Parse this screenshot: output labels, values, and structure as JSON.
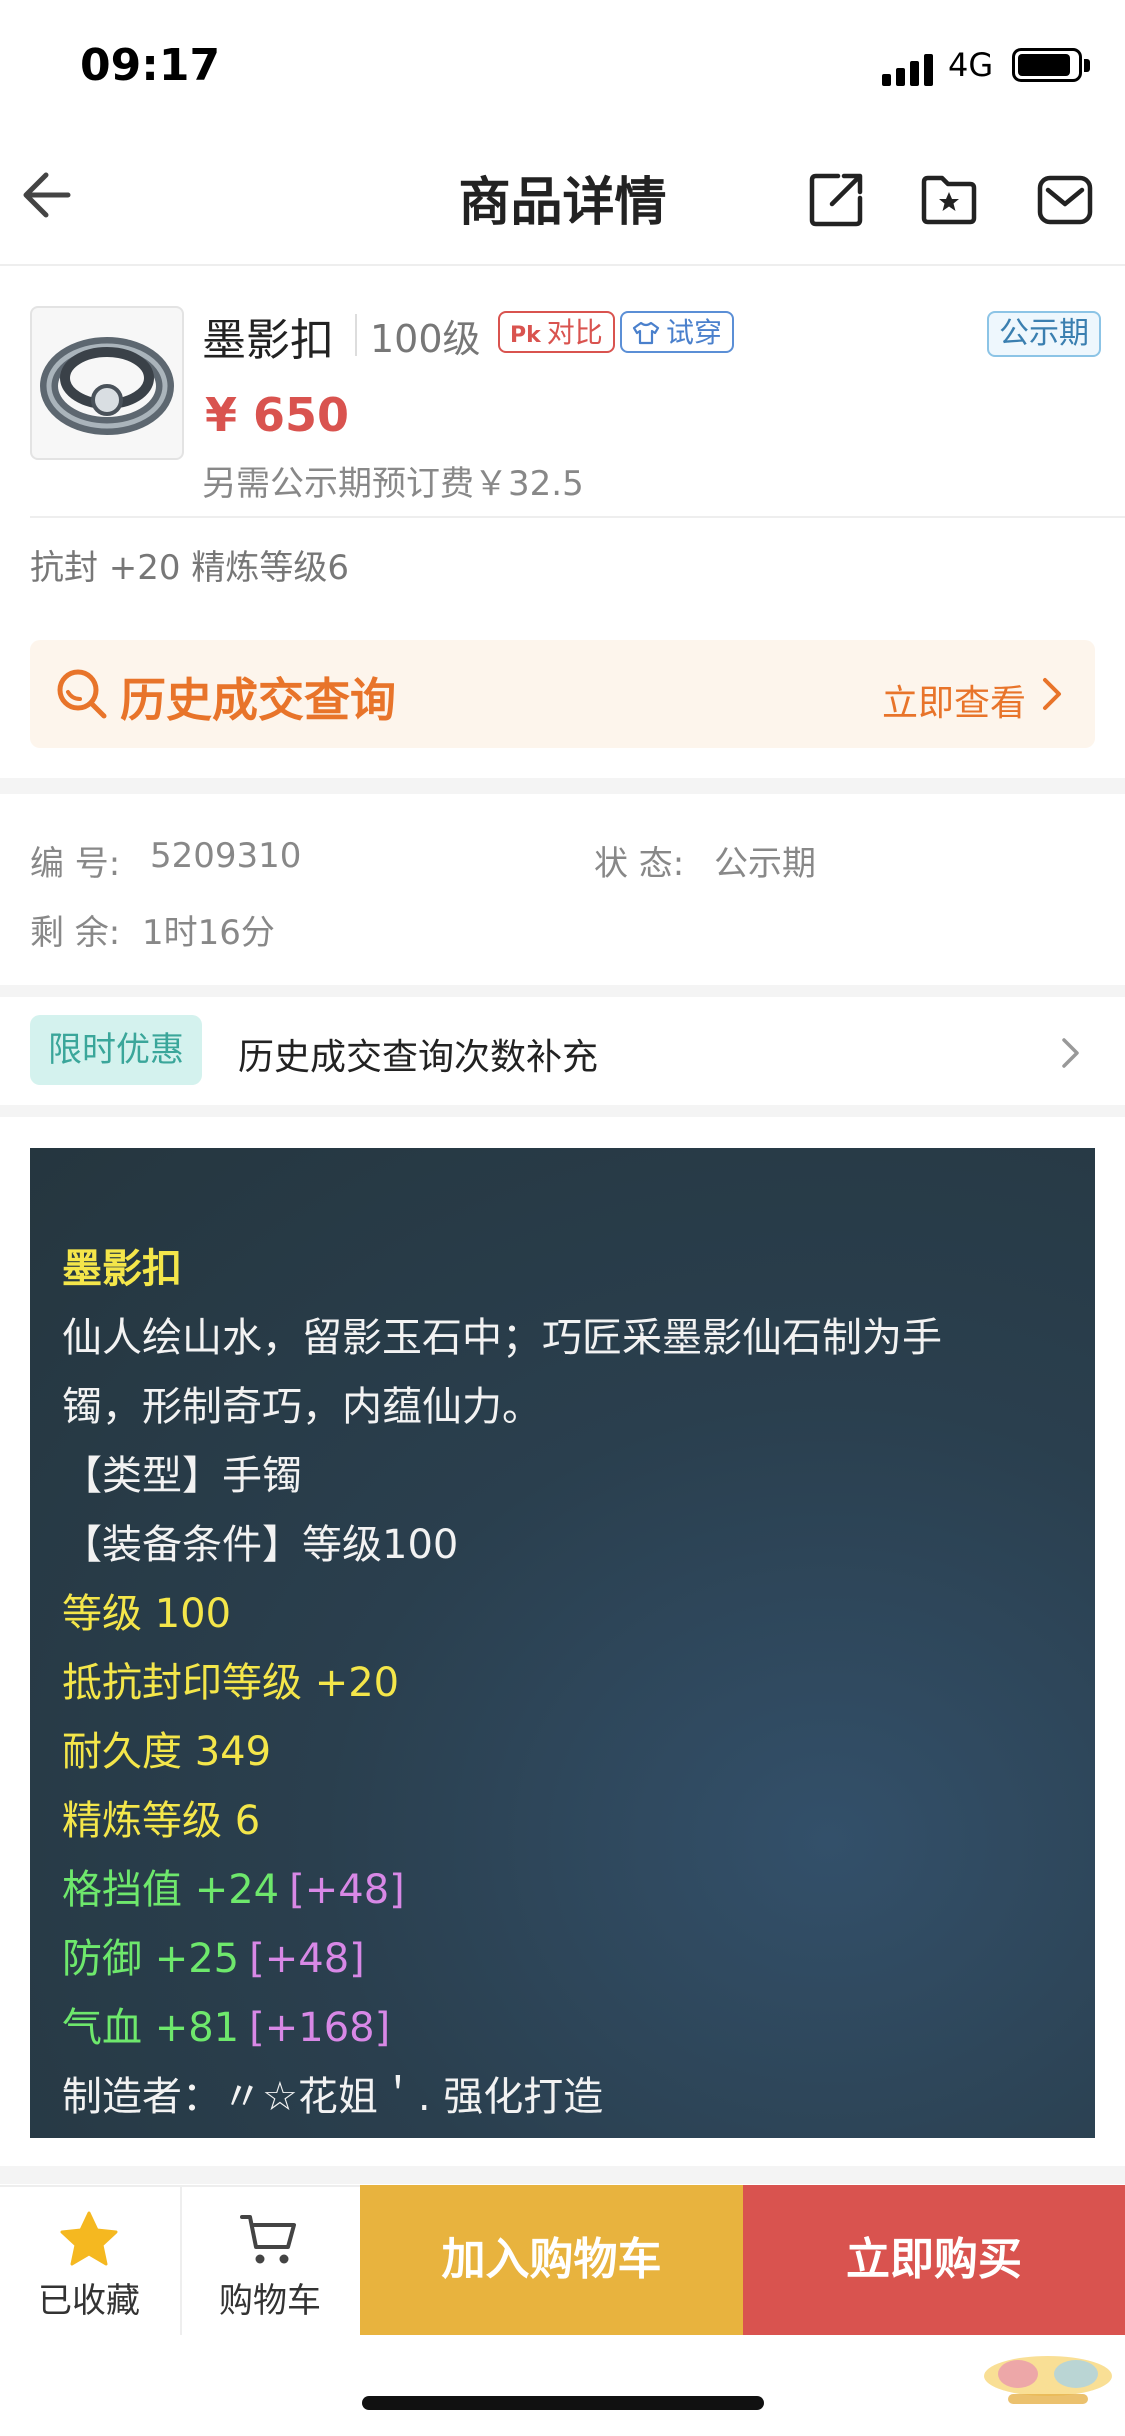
{
  "status_bar": {
    "time": "09:17",
    "network": "4G"
  },
  "nav": {
    "title": "商品详情"
  },
  "product": {
    "name": "墨影扣",
    "level": "100级",
    "tag_compare": "对比",
    "tag_compare_prefix": "Pk",
    "tag_try": "试穿",
    "status_tag": "公示期",
    "price": "¥ 650",
    "price_note": "另需公示期预订费￥32.5",
    "attributes": "抗封 +20 精炼等级6"
  },
  "history": {
    "label": "历史成交查询",
    "link": "立即查看"
  },
  "info": {
    "id_label": "编 号:",
    "id_value": "5209310",
    "state_label": "状 态:",
    "state_value": "公示期",
    "remain_label": "剩 余:",
    "remain_value": "1时16分"
  },
  "promo": {
    "badge": "限时优惠",
    "text": "历史成交查询次数补充"
  },
  "description": {
    "title": "墨影扣",
    "lore_1": "仙人绘山水，留影玉石中；巧匠采墨影仙石制为手",
    "lore_2": "镯，形制奇巧，内蕴仙力。",
    "type_line": "【类型】手镯",
    "equip_line": "【装备条件】等级100",
    "level_line": "等级 100",
    "seal_line": "抵抗封印等级 +20",
    "durability_line": "耐久度 349",
    "refine_line": "精炼等级 6",
    "block_line": "格挡值 +24",
    "block_bonus": "[+48]",
    "defense_line": "防御 +25",
    "defense_bonus": "[+48]",
    "hp_line": "气血 +81",
    "hp_bonus": "[+168]",
    "maker_line": "制造者：〃☆花姐＇. 强化打造"
  },
  "bottom": {
    "favorited": "已收藏",
    "cart": "购物车",
    "add_to_cart": "加入购物车",
    "buy_now": "立即购买"
  },
  "colors": {
    "accent_red": "#d9534f",
    "accent_orange": "#e8742a",
    "cart_button": "#e8b33e",
    "desc_background": "#2a3f4e"
  }
}
